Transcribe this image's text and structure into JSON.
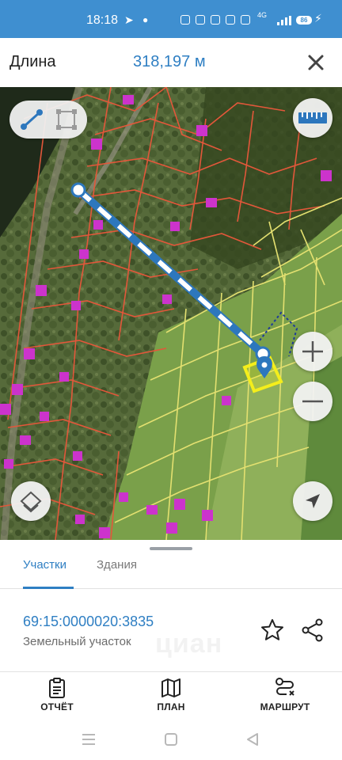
{
  "status_bar": {
    "time": "18:18",
    "telegram_icon": "telegram-icon",
    "network": "4G",
    "battery": "86"
  },
  "header": {
    "title": "Длина",
    "measurement": "318,197 м",
    "close_icon": "close-icon"
  },
  "map": {
    "tools": [
      "line-tool-icon",
      "area-tool-icon"
    ],
    "buttons": [
      "ruler-icon",
      "zoom-in-icon",
      "zoom-out-icon",
      "layers-icon",
      "my-location-icon"
    ],
    "colors": {
      "parcel_outline": "#e2573a",
      "selected_parcel": "#f4ee1b",
      "available_parcels": "#e3e070",
      "measure_line": "#2d77bd",
      "buildings": "#cc33cc"
    }
  },
  "sheet": {
    "tabs": [
      {
        "label": "Участки",
        "active": true
      },
      {
        "label": "Здания",
        "active": false
      }
    ],
    "parcel": {
      "cadastral_number": "69:15:0000020:3835",
      "type": "Земельный участок"
    },
    "watermark": "циан"
  },
  "bottom_nav": [
    {
      "label": "ОТЧЁТ",
      "icon": "report-icon"
    },
    {
      "label": "ПЛАН",
      "icon": "map-plan-icon"
    },
    {
      "label": "МАРШРУТ",
      "icon": "route-icon"
    }
  ],
  "colors": {
    "accent": "#2f7fc3",
    "status_bar": "#3f8fd0"
  }
}
